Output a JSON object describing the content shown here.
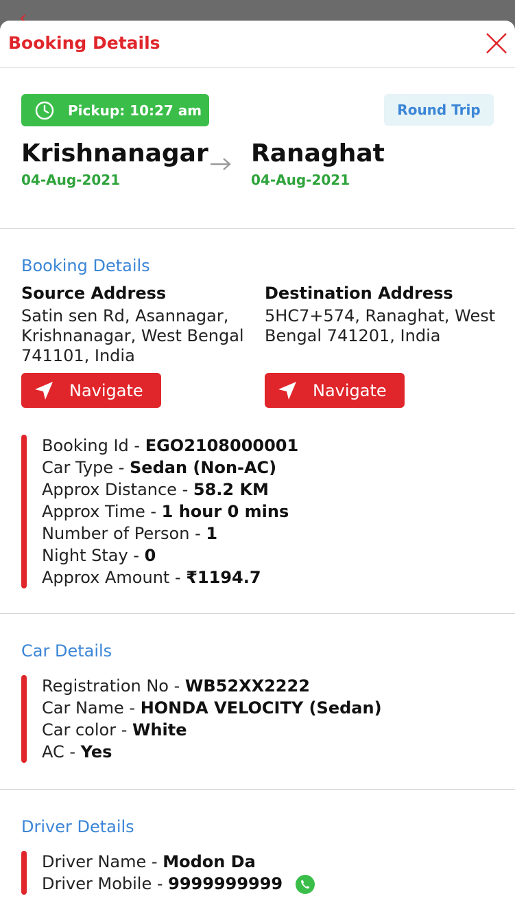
{
  "header": {
    "title": "Booking Details"
  },
  "trip": {
    "pickup_label": "Pickup: 10:27 am",
    "trip_type": "Round Trip",
    "source_city": "Krishnanagar",
    "source_date": "04-Aug-2021",
    "destination_city": "Ranaghat",
    "destination_date": "04-Aug-2021"
  },
  "booking": {
    "heading": "Booking Details",
    "source_title": "Source Address",
    "source_address": "Satin sen Rd, Asannagar, Krishnanagar, West Bengal 741101, India",
    "destination_title": "Destination Address",
    "destination_address": "5HC7+574, Ranaghat, West Bengal 741201, India",
    "navigate_label": "Navigate",
    "details": [
      {
        "label": "Booking Id - ",
        "value": "EGO2108000001"
      },
      {
        "label": "Car Type - ",
        "value": "Sedan (Non-AC)"
      },
      {
        "label": "Approx Distance - ",
        "value": "58.2 KM"
      },
      {
        "label": "Approx Time - ",
        "value": "1 hour 0 mins"
      },
      {
        "label": "Number of Person - ",
        "value": "1"
      },
      {
        "label": "Night Stay - ",
        "value": "0"
      },
      {
        "label": "Approx Amount - ",
        "value": "₹1194.7"
      }
    ]
  },
  "car": {
    "heading": "Car Details",
    "details": [
      {
        "label": "Registration No - ",
        "value": "WB52XX2222"
      },
      {
        "label": "Car Name - ",
        "value": "HONDA VELOCITY (Sedan)"
      },
      {
        "label": "Car color - ",
        "value": "White"
      },
      {
        "label": "AC - ",
        "value": "Yes"
      }
    ]
  },
  "driver": {
    "heading": "Driver Details",
    "details": [
      {
        "label": "Driver Name - ",
        "value": "Modon Da"
      },
      {
        "label": "Driver Mobile - ",
        "value": "9999999999"
      }
    ]
  },
  "icons": {
    "close": "close-icon",
    "clock": "clock-icon",
    "arrow": "arrow-right-icon",
    "navigate": "navigation-arrow-icon",
    "phone": "whatsapp-phone-icon"
  },
  "colors": {
    "accent_red": "#e0262b",
    "link_blue": "#3b86d6",
    "success_green": "#3bbd4a",
    "date_green": "#2ea33b"
  }
}
